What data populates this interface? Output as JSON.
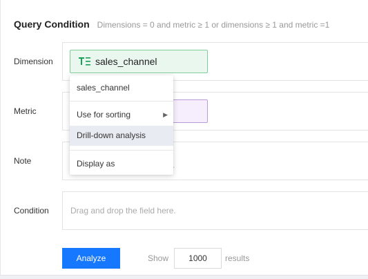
{
  "header": {
    "title": "Query Condition",
    "hint": "Dimensions = 0 and metric ≥ 1 or dimensions ≥ 1 and metric =1"
  },
  "rows": {
    "dimension": {
      "label": "Dimension",
      "field": "sales_channel",
      "field_icon": "text-field-icon"
    },
    "metric": {
      "label": "Metric"
    },
    "note": {
      "label": "Note",
      "peek": "."
    },
    "condition": {
      "label": "Condition",
      "placeholder": "Drag and drop the field here."
    }
  },
  "context_menu": {
    "header": "sales_channel",
    "items": [
      {
        "label": "Use for sorting",
        "has_submenu": true
      },
      {
        "label": "Drill-down analysis",
        "active": true
      },
      {
        "label": "Display as"
      }
    ]
  },
  "footer": {
    "analyze_label": "Analyze",
    "show_label": "Show",
    "count_value": "1000",
    "results_label": "results"
  },
  "colors": {
    "accent": "#1677ff",
    "dimension_chip_bg": "#e9f7ee",
    "dimension_chip_border": "#7fcd98",
    "dimension_icon": "#18a058",
    "metric_chip_bg": "#f6eefc",
    "metric_chip_border": "#b99ad8",
    "menu_active_bg": "#e8ecf2"
  }
}
